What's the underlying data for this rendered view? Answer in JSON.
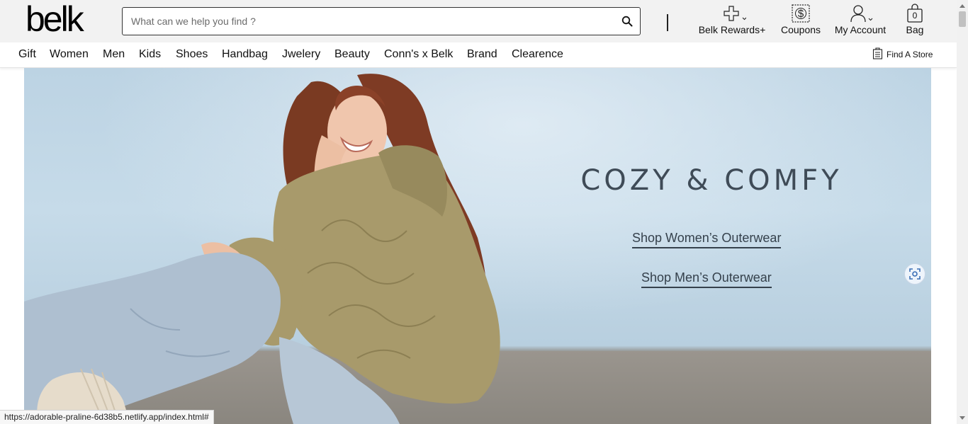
{
  "header": {
    "logo_text": "belk",
    "search_placeholder": "What can we help you find ?",
    "rewards_label": "Belk Rewards+",
    "coupons_label": "Coupons",
    "account_label": "My Account",
    "bag_label": "Bag",
    "bag_count": "0"
  },
  "nav": {
    "items": [
      "Gift",
      "Women",
      "Men",
      "Kids",
      "Shoes",
      "Handbag",
      "Jwelery",
      "Beauty",
      "Conn's x Belk",
      "Brand",
      "Clearence"
    ],
    "find_store_label": "Find A Store"
  },
  "hero": {
    "headline": "COZY & COMFY",
    "cta_women": "Shop Women’s Outerwear",
    "cta_men": "Shop Men’s Outerwear"
  },
  "statusbar": {
    "url": "https://adorable-praline-6d38b5.netlify.app/index.html#"
  },
  "colors": {
    "header_bg": "#f2f2f2",
    "hero_sky": "#c6dbe9",
    "headline_text": "#3f4b57"
  }
}
